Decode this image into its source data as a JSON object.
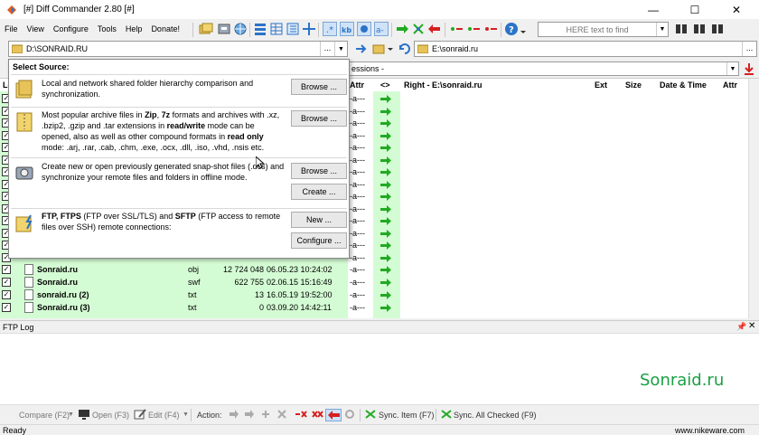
{
  "window": {
    "title": "[#] Diff Commander 2.80 [#]",
    "minimize": "—",
    "maximize": "☐",
    "close": "✕"
  },
  "menu": [
    "File",
    "View",
    "Configure",
    "Tools",
    "Help",
    "Donate!"
  ],
  "search": {
    "placeholder": "HERE text to find"
  },
  "left_path": {
    "value": "D:\\SONRAID.RU",
    "browse": "..."
  },
  "right_path": {
    "value": "E:\\sonraid.ru",
    "browse": "..."
  },
  "session": {
    "label": "essions -"
  },
  "columns": {
    "left_partial": "Le",
    "attr": "Attr",
    "compare": "<>",
    "right": "Right - E:\\sonraid.ru",
    "ext": "Ext",
    "size": "Size",
    "datetime": "Date & Time",
    "right_attr": "Attr"
  },
  "rows_top": [
    {
      "attr": "-a---"
    },
    {
      "attr": "-a---"
    },
    {
      "attr": "-a---"
    },
    {
      "attr": "-a---"
    },
    {
      "attr": "-a---"
    },
    {
      "attr": "-a---"
    },
    {
      "attr": "-a---"
    },
    {
      "attr": "-a---"
    },
    {
      "attr": "-a---"
    },
    {
      "attr": "-a---"
    },
    {
      "attr": "-a---"
    },
    {
      "attr": "-a---"
    },
    {
      "attr": "-a---"
    },
    {
      "attr": "-a---"
    }
  ],
  "rows": [
    {
      "name": "Sonraid.ru",
      "ext": "obj",
      "size": "12 724 048",
      "date": "06.05.23 10:24:02",
      "attr": "-a---"
    },
    {
      "name": "Sonraid.ru",
      "ext": "swf",
      "size": "622 755",
      "date": "02.06.15 15:16:49",
      "attr": "-a---"
    },
    {
      "name": "sonraid.ru (2)",
      "ext": "txt",
      "size": "13",
      "date": "16.05.19 19:52:00",
      "attr": "-a---"
    },
    {
      "name": "Sonraid.ru (3)",
      "ext": "txt",
      "size": "0",
      "date": "03.09.20 14:42:11",
      "attr": "-a---"
    }
  ],
  "popup": {
    "heading": "Select Source:",
    "sections": [
      {
        "text": "Local and network shared folder hierarchy comparison and synchronization.",
        "buttons": [
          "Browse ..."
        ]
      },
      {
        "text_parts": [
          "Most popular archive files in ",
          "Zip",
          ", ",
          "7z",
          " formats and archives with .xz, .bzip2, .gzip and .tar extensions in ",
          "read/write",
          " mode can be opened, also as well as other compound formats in ",
          "read only",
          " mode: .arj, .rar, .cab, .chm, .exe, .ocx, .dll, .iso, .vhd, .nsis etc."
        ],
        "buttons": [
          "Browse ..."
        ]
      },
      {
        "text": "Create new or open previously generated snap-shot files (.dcs) and synchronize your remote files and folders in offline mode.",
        "buttons": [
          "Browse ...",
          "Create ..."
        ]
      },
      {
        "text_parts": [
          "FTP, FTPS",
          " (FTP over SSL/TLS) and ",
          "SFTP",
          " (FTP access to remote files over SSH) remote connections:"
        ],
        "buttons": [
          "New ...",
          "Configure ..."
        ]
      }
    ]
  },
  "ftp_log": {
    "title": "FTP Log",
    "pin": "📌",
    "close": "✕"
  },
  "watermark": "Sonraid.ru",
  "bottom": {
    "compare": "Compare (F2)",
    "open": "Open (F3)",
    "edit": "Edit (F4)",
    "action": "Action:",
    "sync_item": "Sync. Item (F7)",
    "sync_all": "Sync. All Checked (F9)"
  },
  "status": {
    "left": "Ready",
    "right": "www.nikeware.com"
  },
  "colors": {
    "green_row": "#d4fcd4",
    "arrow_green": "#22aa22",
    "arrow_red": "#d42020",
    "accent_blue": "#2b73c8",
    "watermark_green": "#1aa043"
  }
}
